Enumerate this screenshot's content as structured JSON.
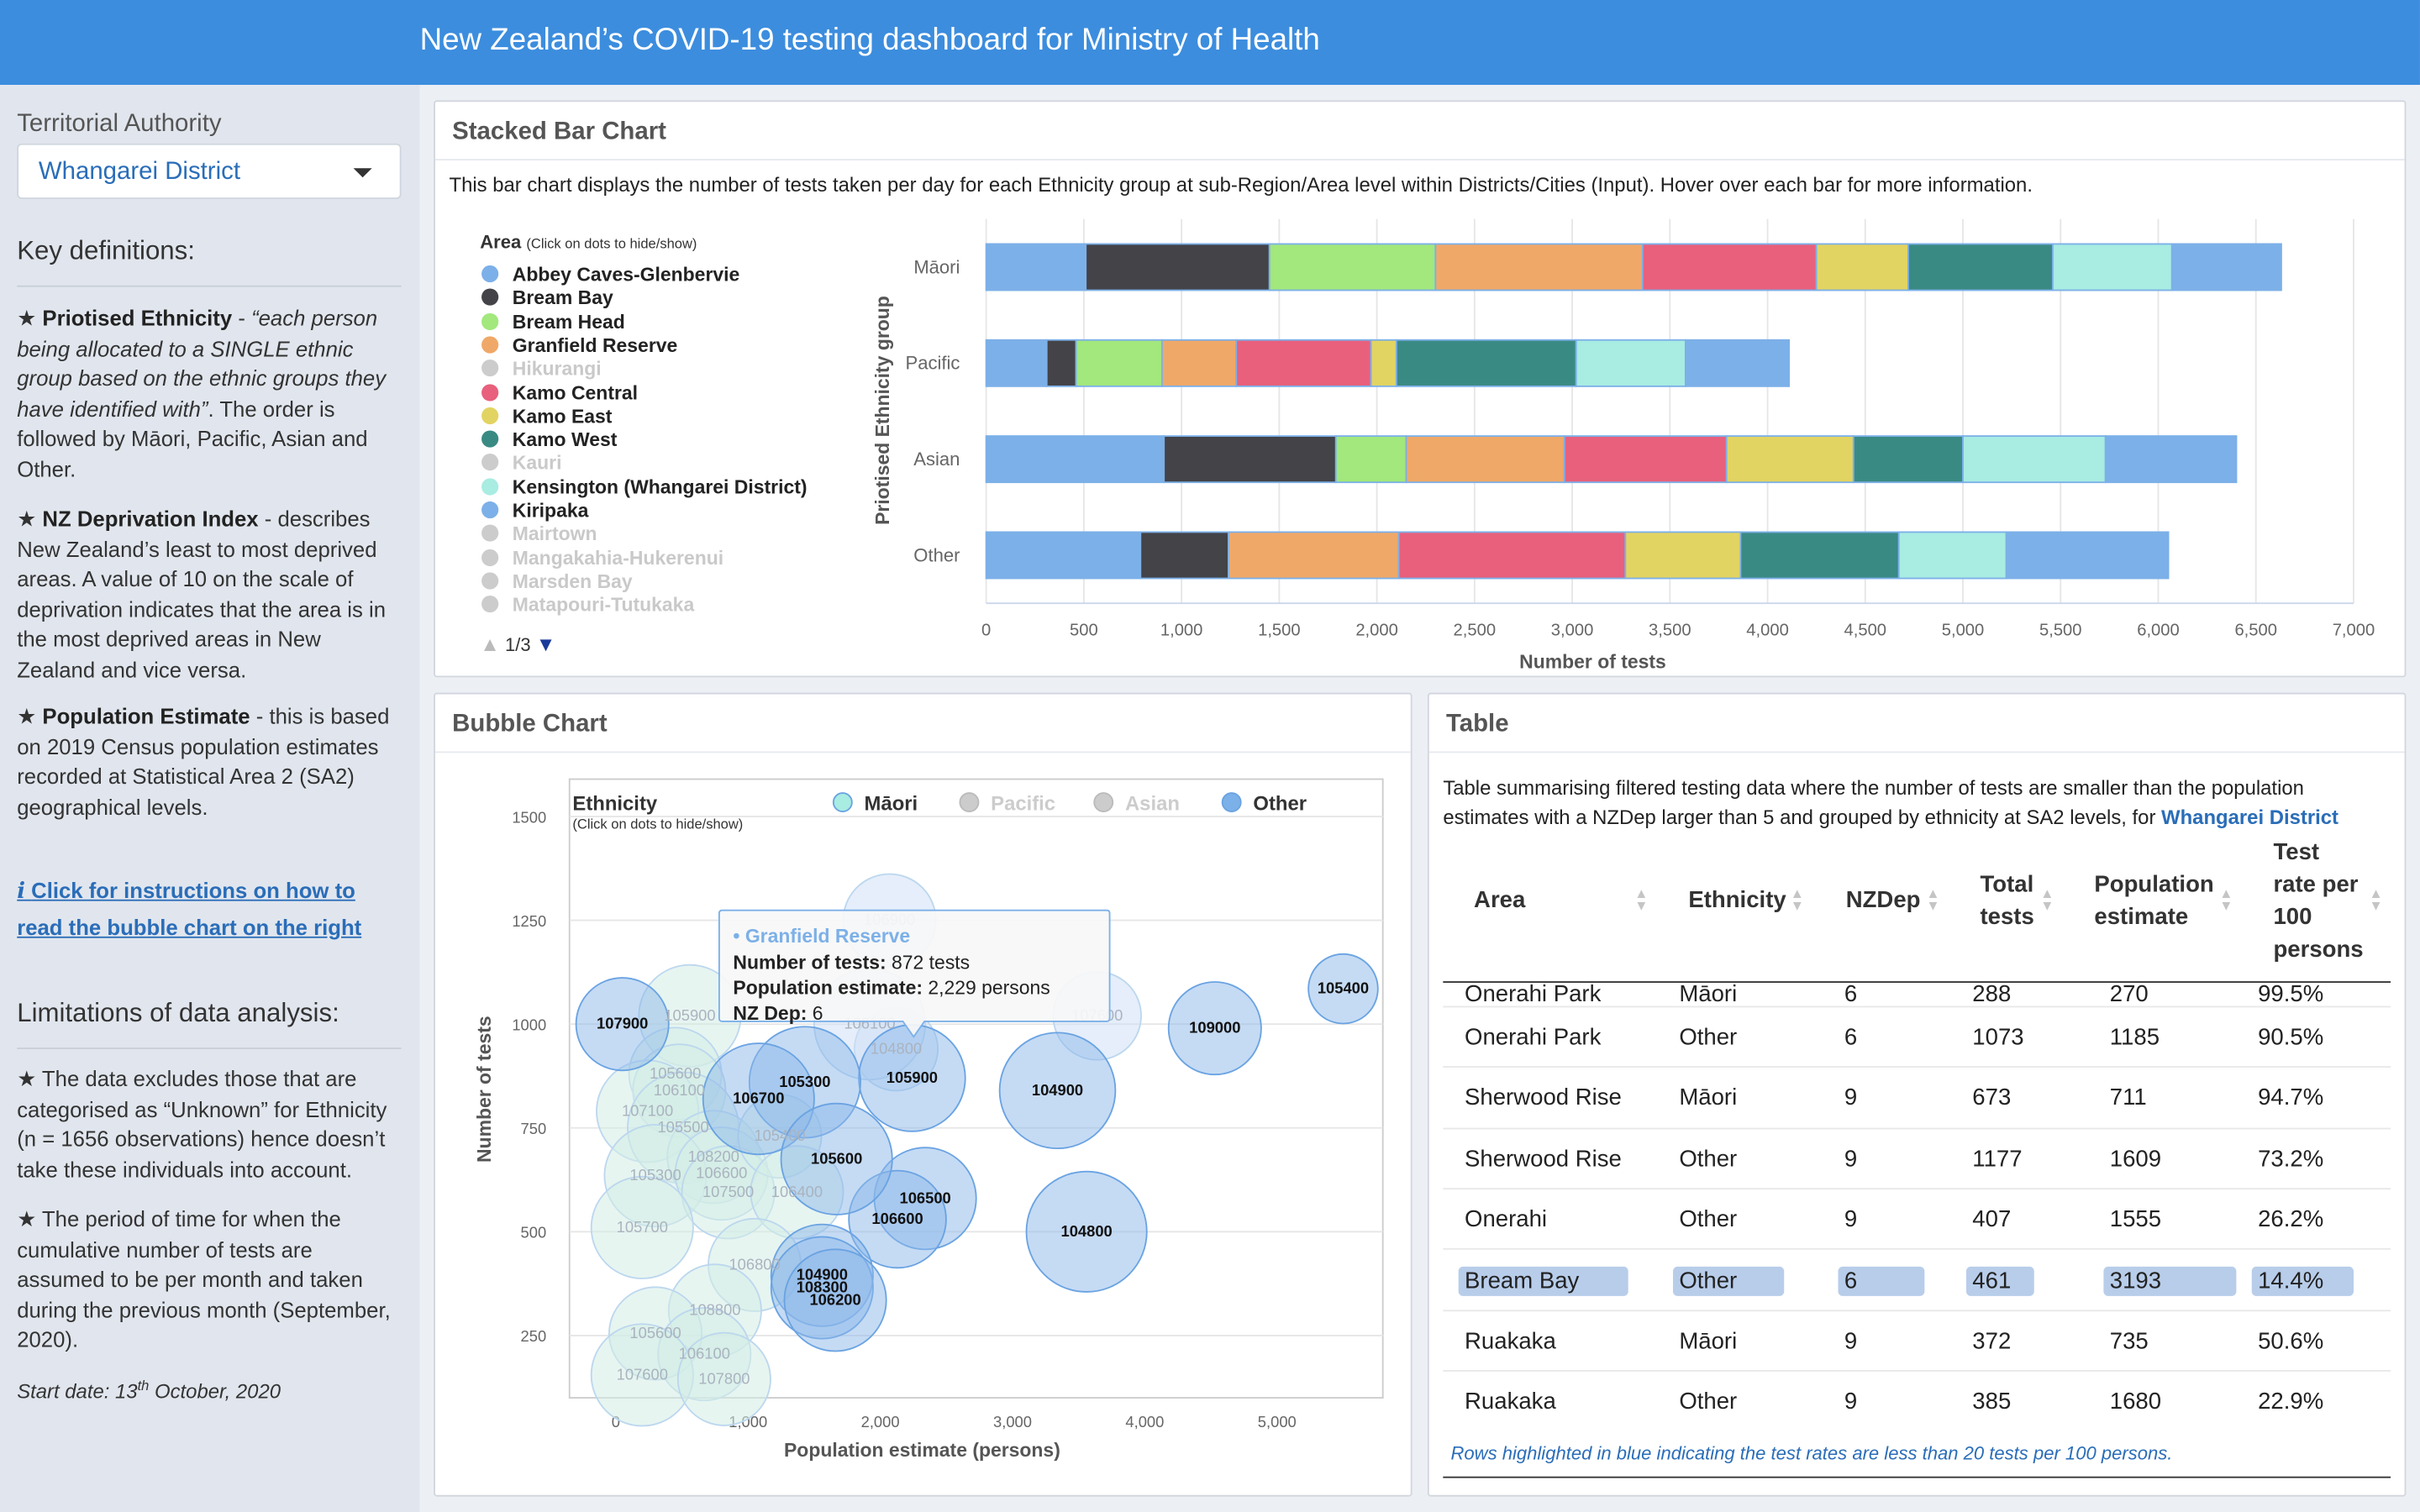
{
  "header": {
    "title": "New Zealand’s COVID-19 testing dashboard for Ministry of Health"
  },
  "sidebar": {
    "select_label": "Territorial Authority",
    "select_value": "Whangarei District",
    "key_definitions_heading": "Key definitions:",
    "def1_term": "Priotised Ethnicity",
    "def1_quote": "“each person being allocated to a SINGLE ethnic group based on the ethnic groups they have identified with”",
    "def1_rest": ". The order is followed by Māori, Pacific, Asian and Other.",
    "def2_term": "NZ Deprivation Index",
    "def2_text": " - describes New Zealand’s least to most deprived areas. A value of 10 on the scale of deprivation indicates that the area is in the most deprived areas in New Zealand and vice versa.",
    "def3_term": "Population Estimate",
    "def3_text": " - this is based on 2019 Census population estimates recorded at Statistical Area 2 (SA2) geographical levels.",
    "link_text": "Click for instructions on how to read the bubble chart on the right",
    "limitations_heading": "Limitations of data analysis:",
    "lim1": "The data excludes those that are categorised as “Unknown” for Ethnicity (n = 1656 observations) hence doesn’t take these individuals into account.",
    "lim2": "The period of time for when the cumulative number of tests are assumed to be per month and taken during the previous month (September, 2020).",
    "start_prefix": "Start date: 13",
    "start_sup": "th",
    "start_suffix": " October, 2020"
  },
  "bar_box": {
    "title": "Stacked Bar Chart",
    "description": "This bar chart displays the number of tests taken per day for each Ethnicity group at sub-Region/Area level within Districts/Cities (Input). Hover over each bar for more information.",
    "legend_title": "Area",
    "legend_hint": "(Click on dots to hide/show)",
    "legend_items": [
      {
        "label": "Abbey Caves-Glenbervie",
        "color": "#7cb0e8",
        "visible": true
      },
      {
        "label": "Bream Bay",
        "color": "#434348",
        "visible": true
      },
      {
        "label": "Bream Head",
        "color": "#a2e87c",
        "visible": true
      },
      {
        "label": "Granfield Reserve",
        "color": "#f0a868",
        "visible": true
      },
      {
        "label": "Hikurangi",
        "color": "#cccccc",
        "visible": false
      },
      {
        "label": "Kamo Central",
        "color": "#e8607c",
        "visible": true
      },
      {
        "label": "Kamo East",
        "color": "#e2d462",
        "visible": true
      },
      {
        "label": "Kamo West",
        "color": "#3a8a84",
        "visible": true
      },
      {
        "label": "Kauri",
        "color": "#cccccc",
        "visible": false
      },
      {
        "label": "Kensington (Whangarei District)",
        "color": "#a8ece2",
        "visible": true
      },
      {
        "label": "Kiripaka",
        "color": "#7cb0e8",
        "visible": true
      },
      {
        "label": "Mairtown",
        "color": "#cccccc",
        "visible": false
      },
      {
        "label": "Mangakahia-Hukerenui",
        "color": "#cccccc",
        "visible": false
      },
      {
        "label": "Marsden Bay",
        "color": "#cccccc",
        "visible": false
      },
      {
        "label": "Matapouri-Tutukaka",
        "color": "#cccccc",
        "visible": false
      }
    ],
    "pager": "1/3"
  },
  "chart_data": [
    {
      "type": "bar",
      "title": "",
      "orientation": "horizontal",
      "stacked": true,
      "xlabel": "Number of tests",
      "ylabel": "Priotised Ethnicity group",
      "xlim": [
        0,
        7000
      ],
      "xticks": [
        0,
        500,
        1000,
        1500,
        2000,
        2500,
        3000,
        3500,
        4000,
        4500,
        5000,
        5500,
        6000,
        6500,
        7000
      ],
      "xtick_labels": [
        "0",
        "500",
        "1,000",
        "1,500",
        "2,000",
        "2,500",
        "3,000",
        "3,500",
        "4,000",
        "4,500",
        "5,000",
        "5,500",
        "6,000",
        "6,500",
        "7,000"
      ],
      "categories": [
        "Māori",
        "Pacific",
        "Asian",
        "Other"
      ],
      "series_colors": [
        "#7cb0e8",
        "#434348",
        "#a2e87c",
        "#f0a868",
        "#e8607c",
        "#e2d462",
        "#3a8a84",
        "#a8ece2",
        "#7cb0e8"
      ],
      "series": [
        {
          "name": "Abbey Caves-Glenbervie",
          "values": [
            510,
            310,
            910,
            790
          ]
        },
        {
          "name": "Bream Bay",
          "values": [
            940,
            150,
            880,
            450
          ]
        },
        {
          "name": "Bream Head",
          "values": [
            850,
            440,
            360,
            0
          ]
        },
        {
          "name": "Granfield Reserve",
          "values": [
            1060,
            380,
            810,
            872
          ]
        },
        {
          "name": "Kamo Central",
          "values": [
            890,
            690,
            830,
            1160
          ]
        },
        {
          "name": "Kamo East",
          "values": [
            470,
            130,
            650,
            590
          ]
        },
        {
          "name": "Kamo West",
          "values": [
            740,
            920,
            560,
            810
          ]
        },
        {
          "name": "Kensington (Whangarei District)",
          "values": [
            610,
            560,
            730,
            550
          ]
        },
        {
          "name": "Kiripaka",
          "values": [
            560,
            530,
            670,
            830
          ]
        }
      ]
    },
    {
      "type": "scatter",
      "subtype": "bubble",
      "title": "",
      "xlabel": "Population estimate (persons)",
      "ylabel": "Number of tests",
      "xlim": [
        -350,
        5800
      ],
      "ylim": [
        100,
        1590
      ],
      "xticks": [
        0,
        1000,
        2000,
        3000,
        4000,
        5000
      ],
      "xtick_labels": [
        "0",
        "1,000",
        "2,000",
        "3,000",
        "4,000",
        "5,000"
      ],
      "yticks": [
        250,
        500,
        750,
        1000,
        1250,
        1500
      ],
      "legend_title": "Ethnicity",
      "legend_hint": "(Click on dots to hide/show)",
      "legend": [
        {
          "name": "Māori",
          "color": "#a8ece2",
          "visible": true
        },
        {
          "name": "Pacific",
          "color": "#cccccc",
          "visible": false
        },
        {
          "name": "Asian",
          "color": "#cccccc",
          "visible": false
        },
        {
          "name": "Other",
          "color": "#7cb0e8",
          "visible": true
        }
      ],
      "points": [
        {
          "label": "107900",
          "x": 50,
          "y": 1000,
          "r": 1,
          "series": "Other",
          "shown": true
        },
        {
          "label": "105400",
          "x": 5500,
          "y": 1085,
          "r": 0.75,
          "series": "Other",
          "shown": true
        },
        {
          "label": "109000",
          "x": 4530,
          "y": 990,
          "r": 1,
          "series": "Other",
          "shown": true
        },
        {
          "label": "104900",
          "x": 3340,
          "y": 840,
          "r": 1.25,
          "series": "Other",
          "shown": true
        },
        {
          "label": "104800",
          "x": 3560,
          "y": 500,
          "r": 1.3,
          "series": "Other",
          "shown": true
        },
        {
          "label": "107600",
          "x": 3640,
          "y": 1020,
          "r": 0.95,
          "series": "Other",
          "shown": false
        },
        {
          "label": "106500",
          "x": 2340,
          "y": 580,
          "r": 1.1,
          "series": "Other",
          "shown": true
        },
        {
          "label": "106600",
          "x": 2130,
          "y": 530,
          "r": 1.05,
          "series": "Other",
          "shown": true
        },
        {
          "label": "105900",
          "x": 2240,
          "y": 870,
          "r": 1.15,
          "series": "Other",
          "shown": true
        },
        {
          "label": "105300",
          "x": 1430,
          "y": 860,
          "r": 1.2,
          "series": "Other",
          "shown": true
        },
        {
          "label": "106700",
          "x": 1080,
          "y": 820,
          "r": 1.2,
          "series": "Other",
          "shown": true
        },
        {
          "label": "105600",
          "x": 1670,
          "y": 675,
          "r": 1.2,
          "series": "Other",
          "shown": true
        },
        {
          "label": "104900",
          "x": 1560,
          "y": 395,
          "r": 1.1,
          "series": "Other",
          "shown": true
        },
        {
          "label": "108300",
          "x": 1560,
          "y": 365,
          "r": 1.1,
          "series": "Other",
          "shown": true
        },
        {
          "label": "106200",
          "x": 1660,
          "y": 335,
          "r": 1.1,
          "series": "Other",
          "shown": true
        },
        {
          "label": "104800",
          "x": 2120,
          "y": 940,
          "r": 0.9,
          "series": "Other",
          "shown": false
        },
        {
          "label": "106100",
          "x": 1920,
          "y": 1000,
          "r": 1.2,
          "series": "Other",
          "shown": false
        },
        {
          "label": "106900",
          "x": 2070,
          "y": 1250,
          "r": 1.0,
          "series": "Other",
          "shown": false
        },
        {
          "label": "105900",
          "x": 560,
          "y": 1020,
          "r": 1.1,
          "series": "Māori",
          "shown": false
        },
        {
          "label": "105600",
          "x": 450,
          "y": 880,
          "r": 1.0,
          "series": "Māori",
          "shown": false
        },
        {
          "label": "106100",
          "x": 480,
          "y": 840,
          "r": 1.0,
          "series": "Māori",
          "shown": false
        },
        {
          "label": "107100",
          "x": 240,
          "y": 790,
          "r": 1.1,
          "series": "Māori",
          "shown": false
        },
        {
          "label": "105500",
          "x": 510,
          "y": 750,
          "r": 1.2,
          "series": "Māori",
          "shown": false
        },
        {
          "label": "108200",
          "x": 740,
          "y": 680,
          "r": 1.0,
          "series": "Māori",
          "shown": false
        },
        {
          "label": "105300",
          "x": 300,
          "y": 635,
          "r": 1.1,
          "series": "Māori",
          "shown": false
        },
        {
          "label": "106600",
          "x": 800,
          "y": 640,
          "r": 1.0,
          "series": "Māori",
          "shown": false
        },
        {
          "label": "107500",
          "x": 850,
          "y": 595,
          "r": 1.0,
          "series": "Māori",
          "shown": false
        },
        {
          "label": "105400",
          "x": 1240,
          "y": 730,
          "r": 0.9,
          "series": "Māori",
          "shown": false
        },
        {
          "label": "106400",
          "x": 1370,
          "y": 595,
          "r": 1.0,
          "series": "Māori",
          "shown": false
        },
        {
          "label": "105700",
          "x": 200,
          "y": 510,
          "r": 1.1,
          "series": "Māori",
          "shown": false
        },
        {
          "label": "106800",
          "x": 1050,
          "y": 420,
          "r": 1.0,
          "series": "Māori",
          "shown": false
        },
        {
          "label": "108800",
          "x": 750,
          "y": 310,
          "r": 1.0,
          "series": "Māori",
          "shown": false
        },
        {
          "label": "105600",
          "x": 300,
          "y": 255,
          "r": 1.0,
          "series": "Māori",
          "shown": false
        },
        {
          "label": "106100",
          "x": 670,
          "y": 205,
          "r": 1.0,
          "series": "Māori",
          "shown": false
        },
        {
          "label": "107600",
          "x": 200,
          "y": 155,
          "r": 1.1,
          "series": "Māori",
          "shown": false
        },
        {
          "label": "107800",
          "x": 820,
          "y": 145,
          "r": 1.0,
          "series": "Māori",
          "shown": false
        }
      ],
      "tooltip": {
        "title": "• Granfield Reserve",
        "lines": [
          {
            "key": "Number of tests:",
            "value": "872 tests"
          },
          {
            "key": "Population estimate:",
            "value": "2,229 persons"
          },
          {
            "key": "NZ Dep:",
            "value": "6"
          }
        ]
      }
    },
    {
      "type": "table",
      "columns": [
        "Area",
        "Ethnicity",
        "NZDep",
        "Total tests",
        "Population estimate",
        "Test rate per 100 persons"
      ],
      "rows": [
        {
          "cells": [
            "Onerahi Park",
            "Other",
            "6",
            "1073",
            "1185",
            "90.5%"
          ],
          "highlight": false
        },
        {
          "cells": [
            "Sherwood Rise",
            "Māori",
            "9",
            "673",
            "711",
            "94.7%"
          ],
          "highlight": false
        },
        {
          "cells": [
            "Sherwood Rise",
            "Other",
            "9",
            "1177",
            "1609",
            "73.2%"
          ],
          "highlight": false
        },
        {
          "cells": [
            "Onerahi",
            "Other",
            "9",
            "407",
            "1555",
            "26.2%"
          ],
          "highlight": false
        },
        {
          "cells": [
            "Bream Bay",
            "Other",
            "6",
            "461",
            "3193",
            "14.4%"
          ],
          "highlight": true
        },
        {
          "cells": [
            "Ruakaka",
            "Māori",
            "9",
            "372",
            "735",
            "50.6%"
          ],
          "highlight": false
        },
        {
          "cells": [
            "Ruakaka",
            "Other",
            "9",
            "385",
            "1680",
            "22.9%"
          ],
          "highlight": false
        }
      ],
      "partial_row": [
        "Onerahi Park",
        "Māori",
        "6",
        "288",
        "270",
        "99.5%"
      ]
    }
  ],
  "bubble_box": {
    "title": "Bubble Chart"
  },
  "table_box": {
    "title": "Table",
    "description_prefix": "Table summarising filtered testing data where the number of tests are smaller than the population estimates with a NZDep larger than 5 and grouped by ethnicity at SA2 levels, for ",
    "description_district": "Whangarei District",
    "col_area": "Area",
    "col_ethnicity": "Ethnicity",
    "col_nzdep": "NZDep",
    "col_total_1": "Total",
    "col_total_2": "tests",
    "col_pop_1": "Population",
    "col_pop_2": "estimate",
    "col_rate_1": "Test",
    "col_rate_2": "rate per",
    "col_rate_3": "100",
    "col_rate_4": "persons",
    "footnote": "Rows highlighted in blue indicating the test rates are less than 20 tests per 100 persons."
  },
  "colors": {
    "header": "#3c8dde",
    "sidebar": "#e1e6ee",
    "link": "#2a6db8",
    "highlight": "#b8cdea"
  }
}
